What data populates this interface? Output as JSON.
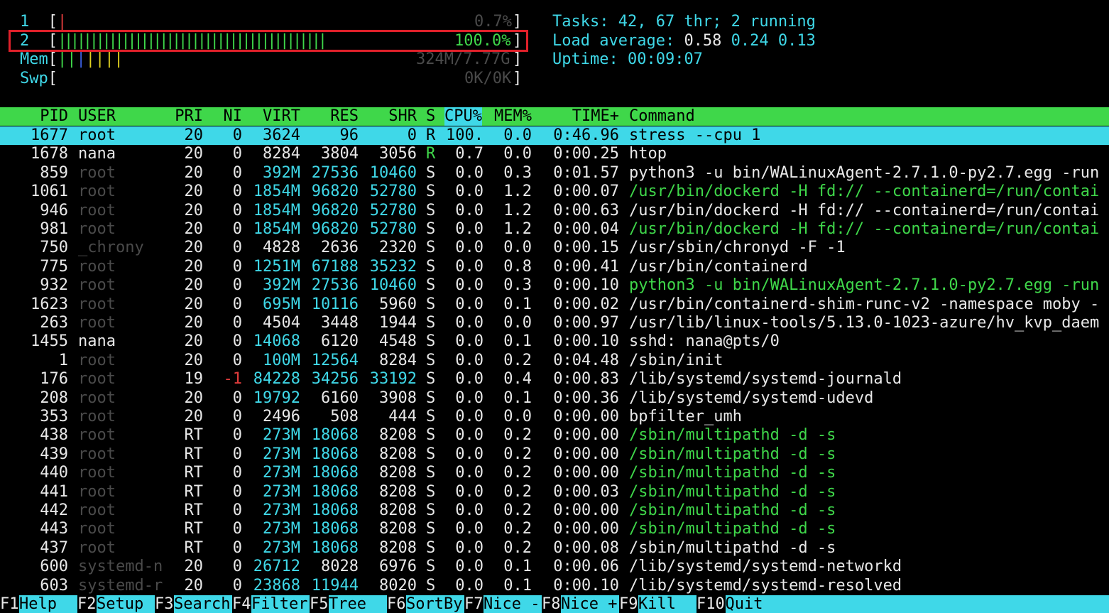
{
  "meters": {
    "cpu1": {
      "label": "1",
      "bars": "|",
      "value": "0.7%",
      "level": 0.007
    },
    "cpu2": {
      "label": "2",
      "bars": "||||||||||||||||||||||||||||||||||||||||||",
      "value": "100.0%",
      "level": 1.0
    },
    "mem": {
      "label": "Mem",
      "value": "324M/7.77G"
    },
    "swp": {
      "label": "Swp",
      "value": "0K/0K"
    }
  },
  "summary": {
    "tasks_label": "Tasks: ",
    "tasks_value": "42, 67 thr; 2 running",
    "load_label": "Load average: ",
    "load_1": "0.58",
    "load_5": "0.24",
    "load_15": "0.13",
    "uptime_label": "Uptime: ",
    "uptime_value": "00:09:07"
  },
  "columns": [
    "PID",
    "USER",
    "PRI",
    "NI",
    "VIRT",
    "RES",
    "SHR",
    "S",
    "CPU%",
    "MEM%",
    "TIME+",
    "Command"
  ],
  "sorted_column": "CPU%",
  "processes": [
    {
      "pid": "1677",
      "user": "root",
      "pri": "20",
      "ni": "0",
      "virt": "3624",
      "res": "96",
      "shr": "0",
      "s": "R",
      "cpu": "100.",
      "mem": "0.0",
      "time": "0:46.96",
      "cmd": "stress --cpu 1"
    },
    {
      "pid": "1678",
      "user": "nana",
      "pri": "20",
      "ni": "0",
      "virt": "8284",
      "res": "3804",
      "shr": "3056",
      "s": "R",
      "cpu": "0.7",
      "mem": "0.0",
      "time": "0:00.25",
      "cmd": "htop"
    },
    {
      "pid": "859",
      "user": "root",
      "pri": "20",
      "ni": "0",
      "virt": "392M",
      "res": "27536",
      "shr": "10460",
      "s": "S",
      "cpu": "0.0",
      "mem": "0.3",
      "time": "0:01.57",
      "cmd": "python3 -u bin/WALinuxAgent-2.7.1.0-py2.7.egg -run"
    },
    {
      "pid": "1061",
      "user": "root",
      "pri": "20",
      "ni": "0",
      "virt": "1854M",
      "res": "96820",
      "shr": "52780",
      "s": "S",
      "cpu": "0.0",
      "mem": "1.2",
      "time": "0:00.07",
      "cmd": "/usr/bin/dockerd -H fd:// --containerd=/run/contai"
    },
    {
      "pid": "946",
      "user": "root",
      "pri": "20",
      "ni": "0",
      "virt": "1854M",
      "res": "96820",
      "shr": "52780",
      "s": "S",
      "cpu": "0.0",
      "mem": "1.2",
      "time": "0:00.63",
      "cmd": "/usr/bin/dockerd -H fd:// --containerd=/run/contai"
    },
    {
      "pid": "981",
      "user": "root",
      "pri": "20",
      "ni": "0",
      "virt": "1854M",
      "res": "96820",
      "shr": "52780",
      "s": "S",
      "cpu": "0.0",
      "mem": "1.2",
      "time": "0:00.04",
      "cmd": "/usr/bin/dockerd -H fd:// --containerd=/run/contai"
    },
    {
      "pid": "750",
      "user": "_chrony",
      "pri": "20",
      "ni": "0",
      "virt": "4828",
      "res": "2636",
      "shr": "2320",
      "s": "S",
      "cpu": "0.0",
      "mem": "0.0",
      "time": "0:00.15",
      "cmd": "/usr/sbin/chronyd -F -1"
    },
    {
      "pid": "775",
      "user": "root",
      "pri": "20",
      "ni": "0",
      "virt": "1251M",
      "res": "67188",
      "shr": "35232",
      "s": "S",
      "cpu": "0.0",
      "mem": "0.8",
      "time": "0:00.41",
      "cmd": "/usr/bin/containerd"
    },
    {
      "pid": "932",
      "user": "root",
      "pri": "20",
      "ni": "0",
      "virt": "392M",
      "res": "27536",
      "shr": "10460",
      "s": "S",
      "cpu": "0.0",
      "mem": "0.3",
      "time": "0:00.10",
      "cmd": "python3 -u bin/WALinuxAgent-2.7.1.0-py2.7.egg -run"
    },
    {
      "pid": "1623",
      "user": "root",
      "pri": "20",
      "ni": "0",
      "virt": "695M",
      "res": "10116",
      "shr": "5960",
      "s": "S",
      "cpu": "0.0",
      "mem": "0.1",
      "time": "0:00.02",
      "cmd": "/usr/bin/containerd-shim-runc-v2 -namespace moby -"
    },
    {
      "pid": "263",
      "user": "root",
      "pri": "20",
      "ni": "0",
      "virt": "4504",
      "res": "3448",
      "shr": "1944",
      "s": "S",
      "cpu": "0.0",
      "mem": "0.0",
      "time": "0:00.97",
      "cmd": "/usr/lib/linux-tools/5.13.0-1023-azure/hv_kvp_daem"
    },
    {
      "pid": "1455",
      "user": "nana",
      "pri": "20",
      "ni": "0",
      "virt": "14068",
      "res": "6120",
      "shr": "4548",
      "s": "S",
      "cpu": "0.0",
      "mem": "0.1",
      "time": "0:00.10",
      "cmd": "sshd: nana@pts/0"
    },
    {
      "pid": "1",
      "user": "root",
      "pri": "20",
      "ni": "0",
      "virt": "100M",
      "res": "12564",
      "shr": "8284",
      "s": "S",
      "cpu": "0.0",
      "mem": "0.2",
      "time": "0:04.48",
      "cmd": "/sbin/init"
    },
    {
      "pid": "176",
      "user": "root",
      "pri": "19",
      "ni": "-1",
      "virt": "84228",
      "res": "34256",
      "shr": "33192",
      "s": "S",
      "cpu": "0.0",
      "mem": "0.4",
      "time": "0:00.83",
      "cmd": "/lib/systemd/systemd-journald"
    },
    {
      "pid": "208",
      "user": "root",
      "pri": "20",
      "ni": "0",
      "virt": "19792",
      "res": "6160",
      "shr": "3908",
      "s": "S",
      "cpu": "0.0",
      "mem": "0.1",
      "time": "0:00.36",
      "cmd": "/lib/systemd/systemd-udevd"
    },
    {
      "pid": "353",
      "user": "root",
      "pri": "20",
      "ni": "0",
      "virt": "2496",
      "res": "508",
      "shr": "444",
      "s": "S",
      "cpu": "0.0",
      "mem": "0.0",
      "time": "0:00.00",
      "cmd": "bpfilter_umh"
    },
    {
      "pid": "438",
      "user": "root",
      "pri": "RT",
      "ni": "0",
      "virt": "273M",
      "res": "18068",
      "shr": "8208",
      "s": "S",
      "cpu": "0.0",
      "mem": "0.2",
      "time": "0:00.00",
      "cmd": "/sbin/multipathd -d -s"
    },
    {
      "pid": "439",
      "user": "root",
      "pri": "RT",
      "ni": "0",
      "virt": "273M",
      "res": "18068",
      "shr": "8208",
      "s": "S",
      "cpu": "0.0",
      "mem": "0.2",
      "time": "0:00.00",
      "cmd": "/sbin/multipathd -d -s"
    },
    {
      "pid": "440",
      "user": "root",
      "pri": "RT",
      "ni": "0",
      "virt": "273M",
      "res": "18068",
      "shr": "8208",
      "s": "S",
      "cpu": "0.0",
      "mem": "0.2",
      "time": "0:00.00",
      "cmd": "/sbin/multipathd -d -s"
    },
    {
      "pid": "441",
      "user": "root",
      "pri": "RT",
      "ni": "0",
      "virt": "273M",
      "res": "18068",
      "shr": "8208",
      "s": "S",
      "cpu": "0.0",
      "mem": "0.2",
      "time": "0:00.03",
      "cmd": "/sbin/multipathd -d -s"
    },
    {
      "pid": "442",
      "user": "root",
      "pri": "RT",
      "ni": "0",
      "virt": "273M",
      "res": "18068",
      "shr": "8208",
      "s": "S",
      "cpu": "0.0",
      "mem": "0.2",
      "time": "0:00.00",
      "cmd": "/sbin/multipathd -d -s"
    },
    {
      "pid": "443",
      "user": "root",
      "pri": "RT",
      "ni": "0",
      "virt": "273M",
      "res": "18068",
      "shr": "8208",
      "s": "S",
      "cpu": "0.0",
      "mem": "0.2",
      "time": "0:00.00",
      "cmd": "/sbin/multipathd -d -s"
    },
    {
      "pid": "437",
      "user": "root",
      "pri": "RT",
      "ni": "0",
      "virt": "273M",
      "res": "18068",
      "shr": "8208",
      "s": "S",
      "cpu": "0.0",
      "mem": "0.2",
      "time": "0:00.08",
      "cmd": "/sbin/multipathd -d -s"
    },
    {
      "pid": "600",
      "user": "systemd-n",
      "pri": "20",
      "ni": "0",
      "virt": "26712",
      "res": "8028",
      "shr": "6976",
      "s": "S",
      "cpu": "0.0",
      "mem": "0.1",
      "time": "0:00.06",
      "cmd": "/lib/systemd/systemd-networkd"
    },
    {
      "pid": "603",
      "user": "systemd-r",
      "pri": "20",
      "ni": "0",
      "virt": "23868",
      "res": "11944",
      "shr": "8020",
      "s": "S",
      "cpu": "0.0",
      "mem": "0.1",
      "time": "0:00.10",
      "cmd": "/lib/systemd/systemd-resolved"
    }
  ],
  "footer": [
    {
      "key": "F1",
      "label": "Help"
    },
    {
      "key": "F2",
      "label": "Setup"
    },
    {
      "key": "F3",
      "label": "Search"
    },
    {
      "key": "F4",
      "label": "Filter"
    },
    {
      "key": "F5",
      "label": "Tree"
    },
    {
      "key": "F6",
      "label": "SortBy"
    },
    {
      "key": "F7",
      "label": "Nice -"
    },
    {
      "key": "F8",
      "label": "Nice +"
    },
    {
      "key": "F9",
      "label": "Kill"
    },
    {
      "key": "F10",
      "label": "Quit"
    }
  ],
  "colors": {
    "accent_green": "#3fd74a",
    "accent_cyan": "#3fd8e8",
    "highlight_red": "#e0202a"
  }
}
